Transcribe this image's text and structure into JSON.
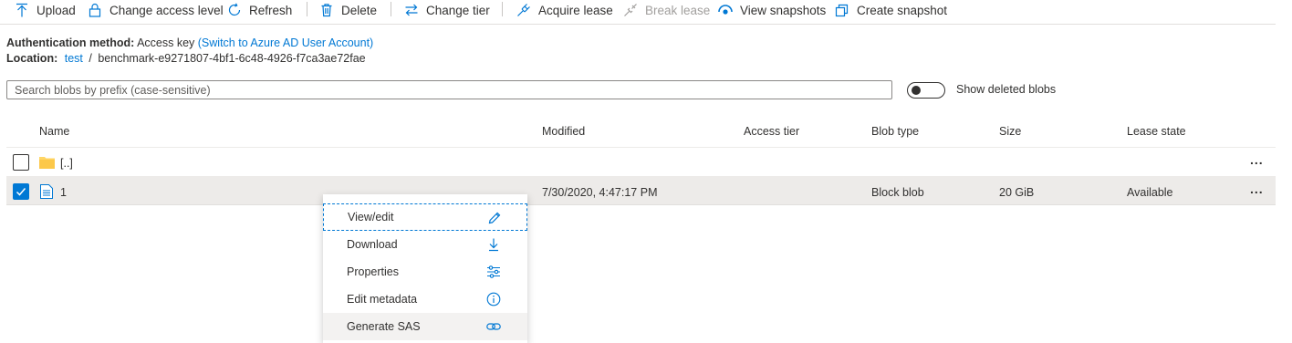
{
  "toolbar": {
    "upload": "Upload",
    "change_access_level": "Change access level",
    "refresh": "Refresh",
    "delete": "Delete",
    "change_tier": "Change tier",
    "acquire_lease": "Acquire lease",
    "break_lease": "Break lease",
    "view_snapshots": "View snapshots",
    "create_snapshot": "Create snapshot"
  },
  "info": {
    "auth_label": "Authentication method:",
    "auth_value": "Access key",
    "auth_link": "(Switch to Azure AD User Account)",
    "location_label": "Location:",
    "location_link": "test",
    "location_sep": "/",
    "location_path": "benchmark-e9271807-4bf1-6c48-4926-f7ca3ae72fae"
  },
  "search": {
    "placeholder": "Search blobs by prefix (case-sensitive)"
  },
  "toggle": {
    "label": "Show deleted blobs",
    "on": false
  },
  "grid": {
    "columns": [
      "Name",
      "Modified",
      "Access tier",
      "Blob type",
      "Size",
      "Lease state"
    ],
    "rows": [
      {
        "name": "[..]",
        "icon": "folder-icon",
        "modified": "",
        "access_tier": "",
        "blob_type": "",
        "size": "",
        "lease_state": "",
        "selected": false
      },
      {
        "name": "1",
        "icon": "file-icon",
        "modified": "7/30/2020, 4:47:17 PM",
        "access_tier": "",
        "blob_type": "Block blob",
        "size": "20 GiB",
        "lease_state": "Available",
        "selected": true
      }
    ],
    "more": "..."
  },
  "context_menu": {
    "items": [
      {
        "label": "View/edit",
        "icon": "pencil-icon"
      },
      {
        "label": "Download",
        "icon": "download-icon"
      },
      {
        "label": "Properties",
        "icon": "sliders-icon"
      },
      {
        "label": "Edit metadata",
        "icon": "info-icon"
      },
      {
        "label": "Generate SAS",
        "icon": "link-icon"
      }
    ]
  },
  "colors": {
    "accent": "#0078d4",
    "selected_row": "#edebe9",
    "text": "#323130",
    "disabled": "#a19f9d"
  }
}
